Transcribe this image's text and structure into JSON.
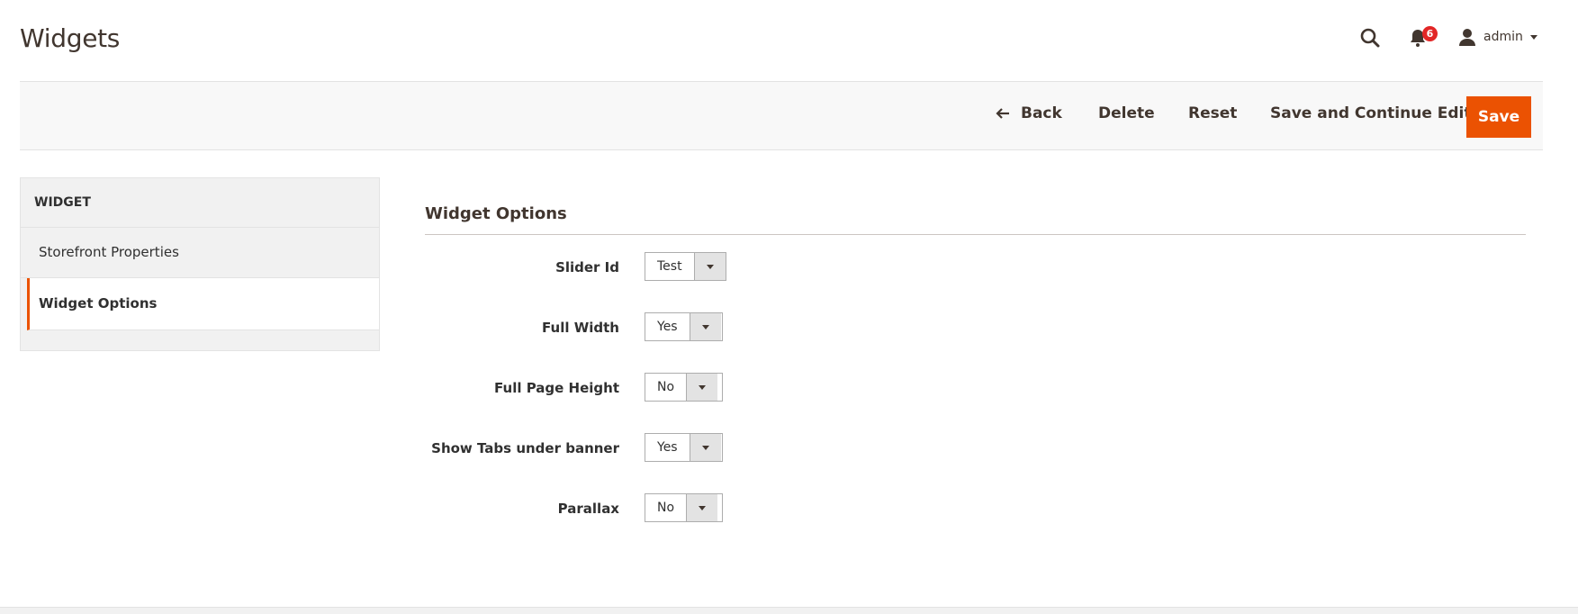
{
  "page": {
    "title": "Widgets"
  },
  "header": {
    "notifications_count": "6",
    "user_name": "admin"
  },
  "actions": {
    "back": "Back",
    "delete": "Delete",
    "reset": "Reset",
    "save_continue": "Save and Continue Edit",
    "save": "Save"
  },
  "sidebar": {
    "title": "WIDGET",
    "items": [
      {
        "label": "Storefront Properties",
        "active": false
      },
      {
        "label": "Widget Options",
        "active": true
      }
    ]
  },
  "section": {
    "title": "Widget Options",
    "fields": [
      {
        "label": "Slider Id",
        "value": "Test"
      },
      {
        "label": "Full Width",
        "value": "Yes"
      },
      {
        "label": "Full Page Height",
        "value": "No"
      },
      {
        "label": "Show Tabs under banner",
        "value": "Yes"
      },
      {
        "label": "Parallax",
        "value": "No"
      }
    ]
  },
  "colors": {
    "accent": "#eb5202",
    "badge": "#e22626"
  },
  "icons": [
    "search-icon",
    "bell-icon",
    "user-icon",
    "arrow-left-icon",
    "chevron-down-icon"
  ]
}
